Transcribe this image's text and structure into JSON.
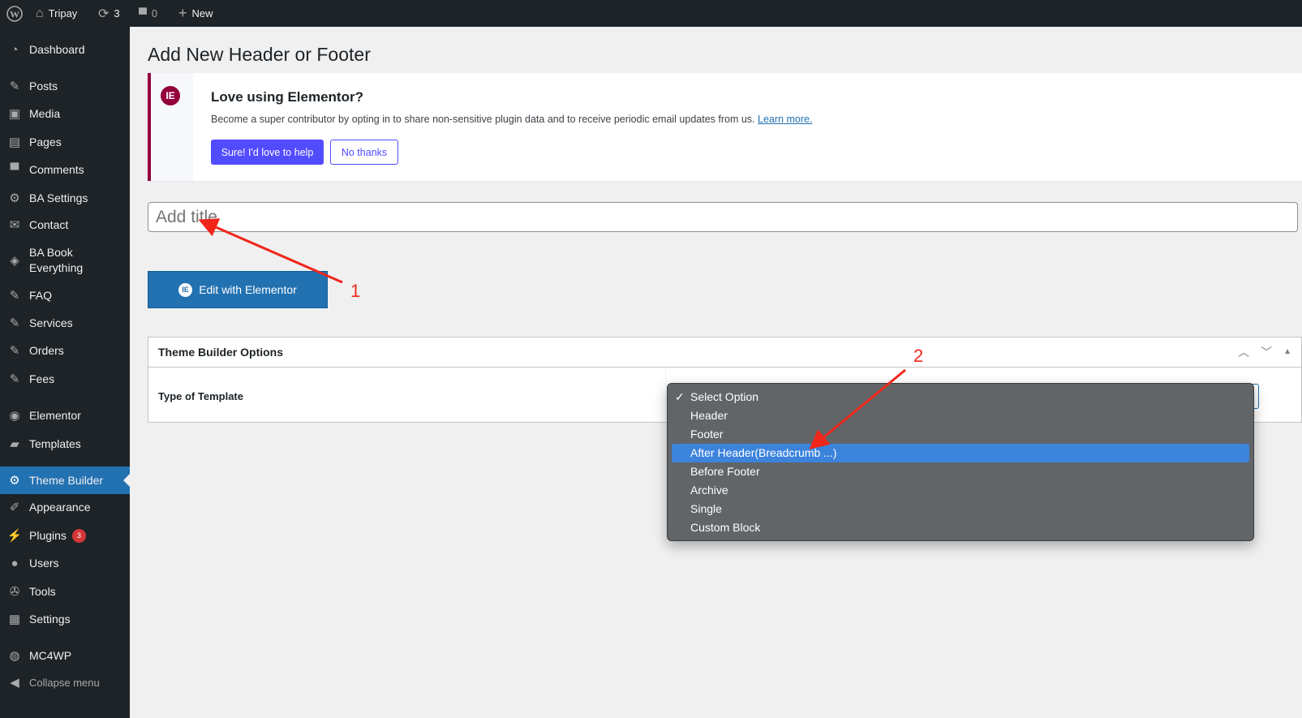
{
  "adminbar": {
    "site": "Tripay",
    "updates": "3",
    "comments": "0",
    "new": "New"
  },
  "sidebar": {
    "items": [
      {
        "label": "Dashboard",
        "icon": "dashboard-icon"
      },
      {
        "label": "Posts",
        "icon": "pin-icon"
      },
      {
        "label": "Media",
        "icon": "media-icon"
      },
      {
        "label": "Pages",
        "icon": "pages-icon"
      },
      {
        "label": "Comments",
        "icon": "comment-icon"
      },
      {
        "label": "BA Settings",
        "icon": "gear-icon"
      },
      {
        "label": "Contact",
        "icon": "mail-icon"
      },
      {
        "label": "BA Book Everything",
        "icon": "tag-icon"
      },
      {
        "label": "FAQ",
        "icon": "pin-icon"
      },
      {
        "label": "Services",
        "icon": "pin-icon"
      },
      {
        "label": "Orders",
        "icon": "pin-icon"
      },
      {
        "label": "Fees",
        "icon": "pin-icon"
      },
      {
        "label": "Elementor",
        "icon": "elementor-icon"
      },
      {
        "label": "Templates",
        "icon": "folder-icon"
      },
      {
        "label": "Theme Builder",
        "icon": "gear-icon",
        "active": true
      },
      {
        "label": "Appearance",
        "icon": "brush-icon"
      },
      {
        "label": "Plugins",
        "icon": "plugin-icon",
        "badge": "3"
      },
      {
        "label": "Users",
        "icon": "user-icon"
      },
      {
        "label": "Tools",
        "icon": "wrench-icon"
      },
      {
        "label": "Settings",
        "icon": "settings-icon"
      },
      {
        "label": "MC4WP",
        "icon": "mc4wp-icon"
      },
      {
        "label": "Collapse menu",
        "icon": "collapse-icon"
      }
    ]
  },
  "page": {
    "title": "Add New Header or Footer"
  },
  "notice": {
    "heading": "Love using Elementor?",
    "text": "Become a super contributor by opting in to share non-sensitive plugin data and to receive periodic email updates from us.",
    "link": "Learn more.",
    "yes": "Sure! I'd love to help",
    "no": "No thanks"
  },
  "title_input": {
    "placeholder": "Add title",
    "value": ""
  },
  "edit_button": "Edit with Elementor",
  "box": {
    "title": "Theme Builder Options",
    "field_label": "Type of Template"
  },
  "dropdown": {
    "options": [
      "Select Option",
      "Header",
      "Footer",
      "After Header(Breadcrumb ...)",
      "Before Footer",
      "Archive",
      "Single",
      "Custom Block"
    ],
    "selected": "Select Option",
    "highlighted": "After Header(Breadcrumb ...)"
  },
  "annotations": {
    "one": "1",
    "two": "2",
    "color": "#f0261b"
  }
}
